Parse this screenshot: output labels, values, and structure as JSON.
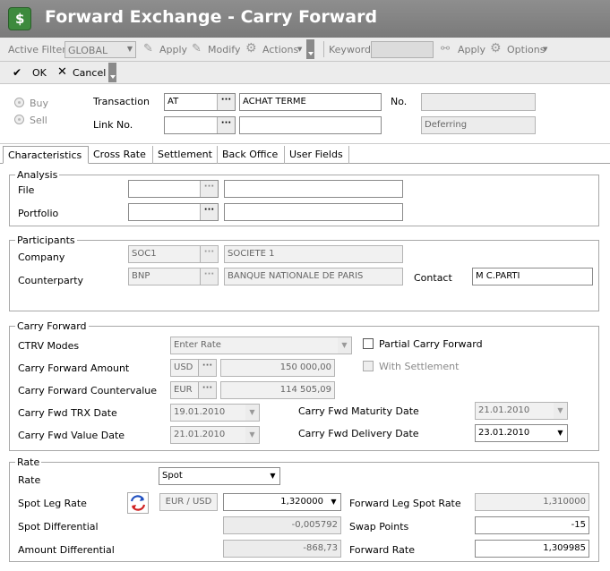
{
  "window": {
    "title": "Forward Exchange - Carry Forward"
  },
  "toolbar1": {
    "active_filter_label": "Active Filter",
    "filter_value": "GLOBAL",
    "apply": "Apply",
    "modify": "Modify",
    "actions": "Actions",
    "keyword_label": "Keyword",
    "keyword_value": "",
    "apply2": "Apply",
    "options": "Options"
  },
  "toolbar2": {
    "ok": "OK",
    "cancel": "Cancel"
  },
  "header": {
    "buy": "Buy",
    "sell": "Sell",
    "transaction_label": "Transaction",
    "transaction_code": "AT",
    "transaction_name": "ACHAT TERME",
    "no_label": "No.",
    "no_value": "",
    "link_label": "Link No.",
    "link_code": "",
    "link_name": "",
    "status": "Deferring"
  },
  "tabs": [
    "Characteristics",
    "Cross Rate",
    "Settlement",
    "Back Office",
    "User Fields"
  ],
  "analysis": {
    "title": "Analysis",
    "file_label": "File",
    "file_code": "",
    "file_name": "",
    "portfolio_label": "Portfolio",
    "portfolio_code": "",
    "portfolio_name": ""
  },
  "participants": {
    "title": "Participants",
    "company_label": "Company",
    "company_code": "SOC1",
    "company_name": "SOCIETE 1",
    "counterparty_label": "Counterparty",
    "counterparty_code": "BNP",
    "counterparty_name": "BANQUE NATIONALE DE PARIS",
    "contact_label": "Contact",
    "contact_value": "M C.PARTI"
  },
  "carry": {
    "title": "Carry Forward",
    "ctrv_label": "CTRV Modes",
    "ctrv_value": "Enter Rate",
    "partial_label": "Partial Carry Forward",
    "with_settlement_label": "With Settlement",
    "amount_label": "Carry Forward Amount",
    "amount_ccy": "USD",
    "amount_value": "150 000,00",
    "countervalue_label": "Carry Forward Countervalue",
    "countervalue_ccy": "EUR",
    "countervalue_value": "114 505,09",
    "trx_label": "Carry Fwd TRX Date",
    "trx_value": "19.01.2010",
    "maturity_label": "Carry Fwd Maturity Date",
    "maturity_value": "21.01.2010",
    "value_label": "Carry Fwd Value Date",
    "value_value": "21.01.2010",
    "delivery_label": "Carry Fwd Delivery Date",
    "delivery_value": "23.01.2010"
  },
  "rate": {
    "title": "Rate",
    "rate_label": "Rate",
    "rate_value": "Spot",
    "spot_leg_label": "Spot Leg Rate",
    "pair": "EUR / USD",
    "spot_leg_value": "1,320000",
    "forward_leg_spot_label": "Forward Leg Spot Rate",
    "forward_leg_spot_value": "1,310000",
    "spot_diff_label": "Spot Differential",
    "spot_diff_value": "-0,005792",
    "swap_points_label": "Swap Points",
    "swap_points_value": "-15",
    "amount_diff_label": "Amount Differential",
    "amount_diff_value": "-868,73",
    "forward_rate_label": "Forward Rate",
    "forward_rate_value": "1,309985"
  },
  "icons": [
    "app-logo-icon",
    "checkmark-icon",
    "close-icon",
    "apply-icon",
    "modify-icon",
    "gear-icon",
    "binoculars-icon",
    "swap-icon"
  ]
}
